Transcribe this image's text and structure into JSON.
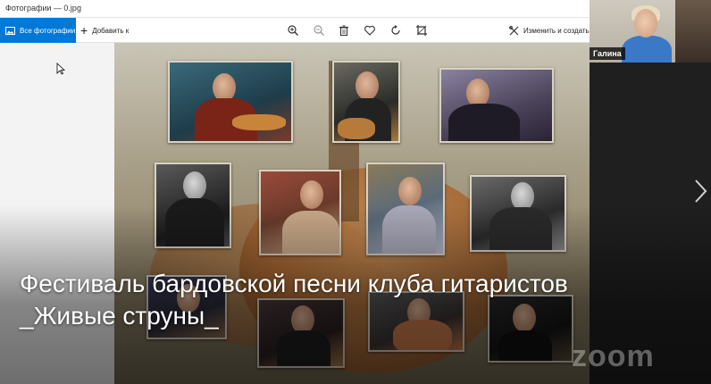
{
  "window": {
    "title": "Фотографии — 0.jpg"
  },
  "toolbar": {
    "all_photos_label": "Все фотографии",
    "add_to_label": "Добавить к",
    "edit_create_label": "Изменить и создать",
    "icons": [
      "zoom-in-icon",
      "zoom-out-icon",
      "delete-icon",
      "favorite-icon",
      "rotate-icon",
      "crop-icon"
    ]
  },
  "caption": {
    "line1": "Фестиваль бардовской песни клуба гитаристов",
    "line2": "_Живые струны_"
  },
  "video": {
    "participant_name": "Галина"
  },
  "watermark": {
    "text": "zoom"
  },
  "colors": {
    "accent": "#0078d7",
    "caption_text": "#ffffff"
  }
}
